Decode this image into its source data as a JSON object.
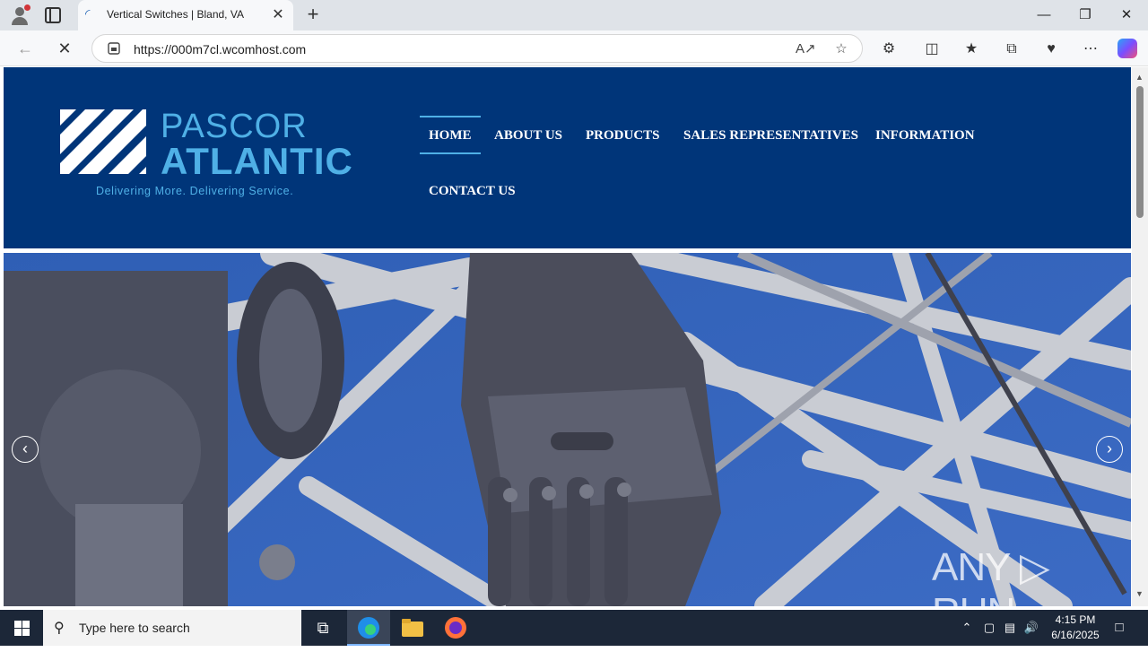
{
  "browser": {
    "tab_title": "Vertical Switches | Bland, VA",
    "url": "https://000m7cl.wcomhost.com",
    "close_tab_symbol": "✕",
    "new_tab_symbol": "+"
  },
  "site": {
    "logo": {
      "line1": "PASCOR",
      "line2": "ATLANTIC",
      "tagline": "Delivering More. Delivering Service."
    },
    "nav": {
      "home": "HOME",
      "about": "ABOUT US",
      "products": "PRODUCTS",
      "sales": "SALES REPRESENTATIVES",
      "information": "INFORMATION",
      "contact": "CONTACT US"
    },
    "slider": {
      "prev_symbol": "‹",
      "next_symbol": "›"
    },
    "watermark": "ANY ▷ RUN",
    "colors": {
      "header_bg": "#003579",
      "logo_accent": "#4fb0e6",
      "nav_text": "#ffffff"
    }
  },
  "taskbar": {
    "search_placeholder": "Type here to search",
    "time": "4:15 PM",
    "date": "6/16/2025"
  },
  "icons": [
    "profile-icon",
    "tab-actions-icon",
    "back-icon",
    "reload-icon",
    "lock-icon",
    "read-aloud-icon",
    "favorite-star-icon",
    "extensions-icon",
    "split-screen-icon",
    "favorites-icon",
    "collections-icon",
    "browser-essentials-icon",
    "more-icon",
    "copilot-icon",
    "windows-start-icon",
    "search-icon",
    "task-view-icon",
    "edge-icon",
    "file-explorer-icon",
    "firefox-icon",
    "notification-icon"
  ]
}
